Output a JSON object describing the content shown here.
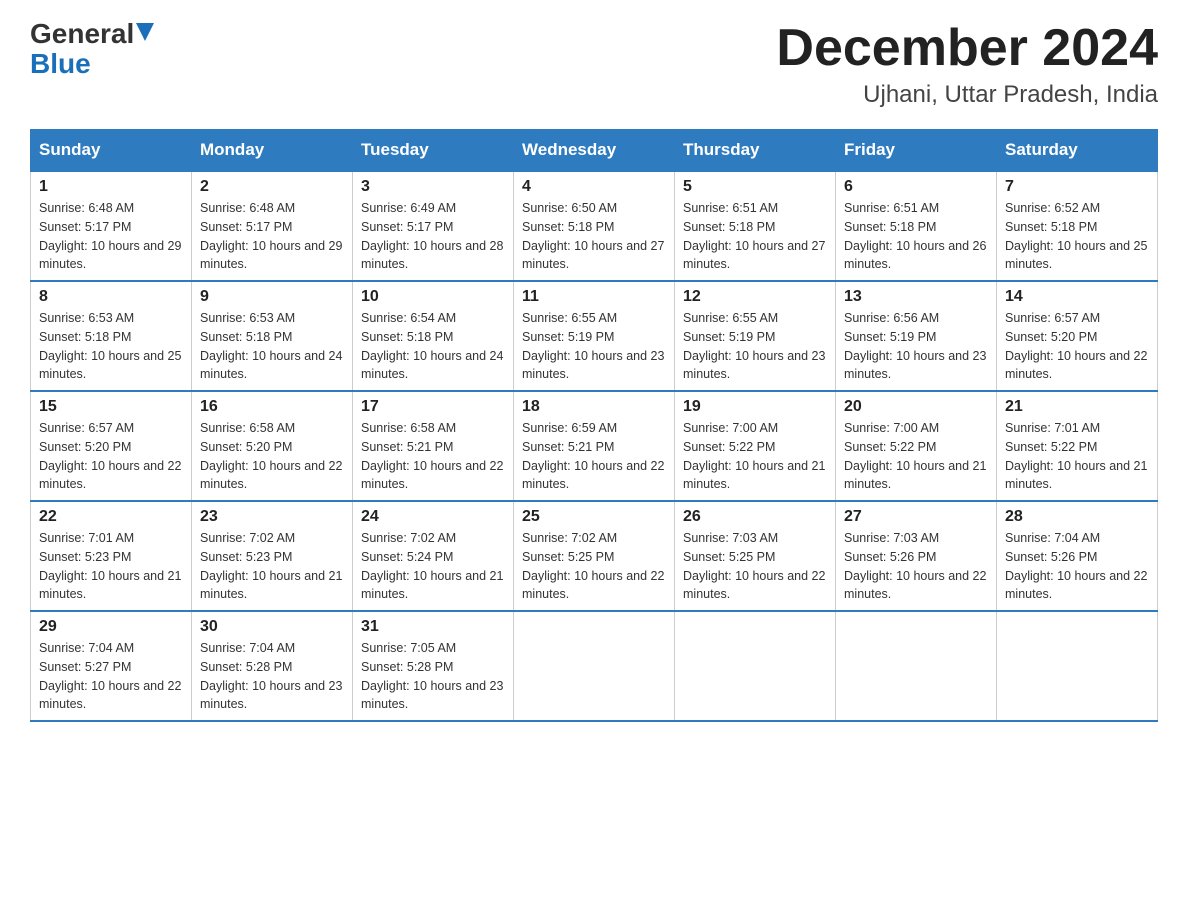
{
  "header": {
    "logo_general": "General",
    "logo_blue": "Blue",
    "month_title": "December 2024",
    "location": "Ujhani, Uttar Pradesh, India"
  },
  "days_of_week": [
    "Sunday",
    "Monday",
    "Tuesday",
    "Wednesday",
    "Thursday",
    "Friday",
    "Saturday"
  ],
  "weeks": [
    [
      {
        "day": "1",
        "sunrise": "6:48 AM",
        "sunset": "5:17 PM",
        "daylight": "10 hours and 29 minutes."
      },
      {
        "day": "2",
        "sunrise": "6:48 AM",
        "sunset": "5:17 PM",
        "daylight": "10 hours and 29 minutes."
      },
      {
        "day": "3",
        "sunrise": "6:49 AM",
        "sunset": "5:17 PM",
        "daylight": "10 hours and 28 minutes."
      },
      {
        "day": "4",
        "sunrise": "6:50 AM",
        "sunset": "5:18 PM",
        "daylight": "10 hours and 27 minutes."
      },
      {
        "day": "5",
        "sunrise": "6:51 AM",
        "sunset": "5:18 PM",
        "daylight": "10 hours and 27 minutes."
      },
      {
        "day": "6",
        "sunrise": "6:51 AM",
        "sunset": "5:18 PM",
        "daylight": "10 hours and 26 minutes."
      },
      {
        "day": "7",
        "sunrise": "6:52 AM",
        "sunset": "5:18 PM",
        "daylight": "10 hours and 25 minutes."
      }
    ],
    [
      {
        "day": "8",
        "sunrise": "6:53 AM",
        "sunset": "5:18 PM",
        "daylight": "10 hours and 25 minutes."
      },
      {
        "day": "9",
        "sunrise": "6:53 AM",
        "sunset": "5:18 PM",
        "daylight": "10 hours and 24 minutes."
      },
      {
        "day": "10",
        "sunrise": "6:54 AM",
        "sunset": "5:18 PM",
        "daylight": "10 hours and 24 minutes."
      },
      {
        "day": "11",
        "sunrise": "6:55 AM",
        "sunset": "5:19 PM",
        "daylight": "10 hours and 23 minutes."
      },
      {
        "day": "12",
        "sunrise": "6:55 AM",
        "sunset": "5:19 PM",
        "daylight": "10 hours and 23 minutes."
      },
      {
        "day": "13",
        "sunrise": "6:56 AM",
        "sunset": "5:19 PM",
        "daylight": "10 hours and 23 minutes."
      },
      {
        "day": "14",
        "sunrise": "6:57 AM",
        "sunset": "5:20 PM",
        "daylight": "10 hours and 22 minutes."
      }
    ],
    [
      {
        "day": "15",
        "sunrise": "6:57 AM",
        "sunset": "5:20 PM",
        "daylight": "10 hours and 22 minutes."
      },
      {
        "day": "16",
        "sunrise": "6:58 AM",
        "sunset": "5:20 PM",
        "daylight": "10 hours and 22 minutes."
      },
      {
        "day": "17",
        "sunrise": "6:58 AM",
        "sunset": "5:21 PM",
        "daylight": "10 hours and 22 minutes."
      },
      {
        "day": "18",
        "sunrise": "6:59 AM",
        "sunset": "5:21 PM",
        "daylight": "10 hours and 22 minutes."
      },
      {
        "day": "19",
        "sunrise": "7:00 AM",
        "sunset": "5:22 PM",
        "daylight": "10 hours and 21 minutes."
      },
      {
        "day": "20",
        "sunrise": "7:00 AM",
        "sunset": "5:22 PM",
        "daylight": "10 hours and 21 minutes."
      },
      {
        "day": "21",
        "sunrise": "7:01 AM",
        "sunset": "5:22 PM",
        "daylight": "10 hours and 21 minutes."
      }
    ],
    [
      {
        "day": "22",
        "sunrise": "7:01 AM",
        "sunset": "5:23 PM",
        "daylight": "10 hours and 21 minutes."
      },
      {
        "day": "23",
        "sunrise": "7:02 AM",
        "sunset": "5:23 PM",
        "daylight": "10 hours and 21 minutes."
      },
      {
        "day": "24",
        "sunrise": "7:02 AM",
        "sunset": "5:24 PM",
        "daylight": "10 hours and 21 minutes."
      },
      {
        "day": "25",
        "sunrise": "7:02 AM",
        "sunset": "5:25 PM",
        "daylight": "10 hours and 22 minutes."
      },
      {
        "day": "26",
        "sunrise": "7:03 AM",
        "sunset": "5:25 PM",
        "daylight": "10 hours and 22 minutes."
      },
      {
        "day": "27",
        "sunrise": "7:03 AM",
        "sunset": "5:26 PM",
        "daylight": "10 hours and 22 minutes."
      },
      {
        "day": "28",
        "sunrise": "7:04 AM",
        "sunset": "5:26 PM",
        "daylight": "10 hours and 22 minutes."
      }
    ],
    [
      {
        "day": "29",
        "sunrise": "7:04 AM",
        "sunset": "5:27 PM",
        "daylight": "10 hours and 22 minutes."
      },
      {
        "day": "30",
        "sunrise": "7:04 AM",
        "sunset": "5:28 PM",
        "daylight": "10 hours and 23 minutes."
      },
      {
        "day": "31",
        "sunrise": "7:05 AM",
        "sunset": "5:28 PM",
        "daylight": "10 hours and 23 minutes."
      },
      null,
      null,
      null,
      null
    ]
  ]
}
